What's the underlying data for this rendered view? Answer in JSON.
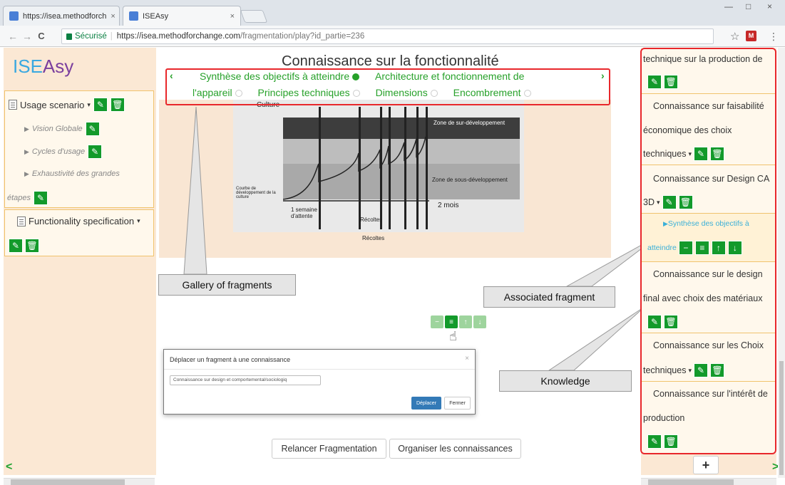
{
  "browser": {
    "tabs": [
      {
        "label": "https://isea.methodforch",
        "close": "×"
      },
      {
        "label": "ISEAsy",
        "close": "×"
      }
    ],
    "window_controls": [
      "—",
      "□",
      "×"
    ],
    "nav": {
      "back": "←",
      "forward": "→",
      "reload": "C"
    },
    "secure_label": "Sécurisé",
    "url_origin": "https://isea.methodforchange.com",
    "url_path": "/fragmentation/play?id_partie=236",
    "star": "☆",
    "ext_label": "M",
    "menu": "⋮"
  },
  "brand": {
    "part1": "ISE",
    "part2": "Asy"
  },
  "left_panel": {
    "usage_scenario": "Usage scenario",
    "sub_items": [
      "Vision Globale",
      "Cycles d'usage",
      "Exhaustivité des grandes",
      "étapes"
    ],
    "functionality": "Functionality specification",
    "nav_prev": "<"
  },
  "main": {
    "title": "Connaissance sur la fonctionnalité",
    "gallery_line1": [
      "Synthèse des objectifs à atteindre",
      "Architecture et fonctionnement de"
    ],
    "gallery_line2": [
      "l'appareil",
      "Principes techniques",
      "Dimensions",
      "Encombrement"
    ],
    "gallery_prev": "‹",
    "gallery_next": "›",
    "photo_labels": {
      "culture": "Culture",
      "zone_over": "Zone de sur-développement",
      "zone_under": "Zone de sous-développement",
      "week": "1 semaine d'attente",
      "months": "2 mois",
      "recoltes": "Récoltes",
      "courbe": "Courbe de développement de la culture"
    },
    "callouts": {
      "gallery": "Gallery of fragments",
      "associated": "Associated fragment",
      "knowledge": "Knowledge"
    },
    "modal": {
      "title": "Déplacer un fragment à une connaissance",
      "close": "×",
      "select_value": "Connaissance sur design et comportemental/sociologiq",
      "confirm": "Déplacer",
      "cancel": "Fermer"
    },
    "buttons": {
      "relaunch": "Relancer Fragmentation",
      "organize": "Organiser les connaissances"
    }
  },
  "right_panel": {
    "items": [
      {
        "lines": [
          "technique sur la production de"
        ]
      },
      {
        "lines": [
          "Connaissance sur faisabilité",
          "économique des choix",
          "techniques"
        ]
      },
      {
        "lines": [
          "Connaissance sur Design CA",
          "3D"
        ]
      },
      {
        "lines": [
          "Synthèse des objectifs à",
          "atteindre"
        ]
      },
      {
        "lines": [
          "Connaissance sur le design",
          "final avec choix des matériaux"
        ]
      },
      {
        "lines": [
          "Connaissance sur les Choix",
          "techniques"
        ]
      },
      {
        "lines": [
          "Connaissance sur l'intérêt de",
          "production"
        ]
      }
    ],
    "add": "+",
    "nav_next": ">"
  },
  "icons": {
    "edit": "✎",
    "delete": "🗑",
    "minus": "−",
    "list": "≡",
    "up": "↑",
    "down": "↓"
  }
}
